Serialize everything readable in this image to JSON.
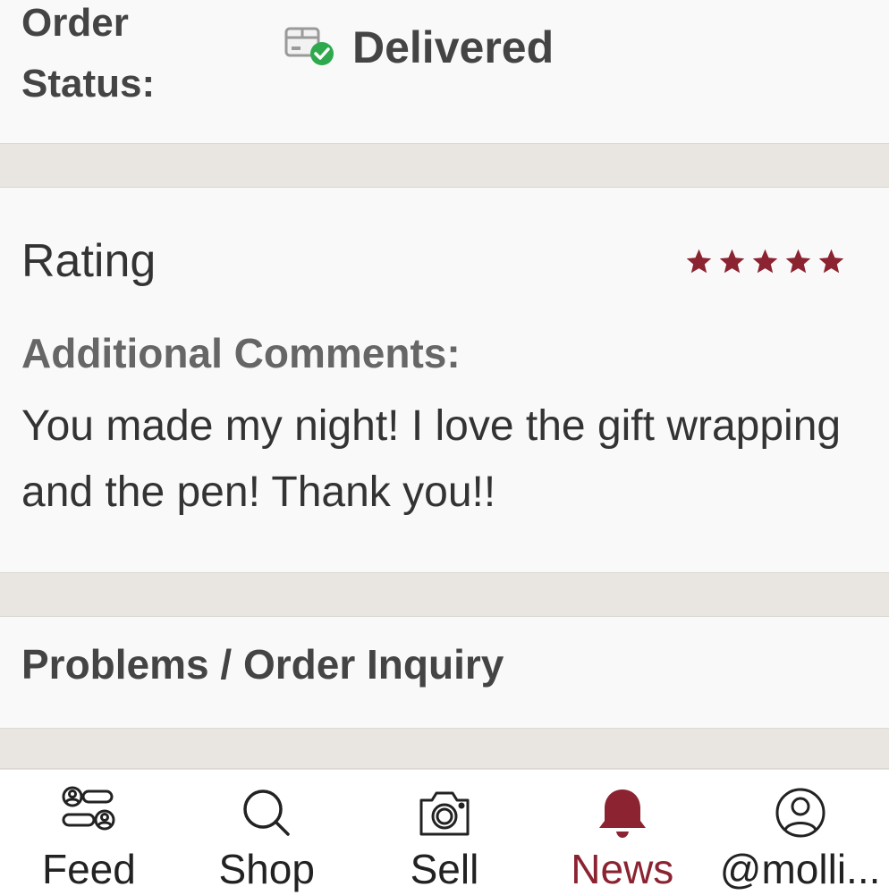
{
  "order_status": {
    "label": "Order Status:",
    "value": "Delivered",
    "icon": "delivered-package-icon"
  },
  "rating": {
    "title": "Rating",
    "stars": 5,
    "max_stars": 5,
    "star_color": "#8b2331"
  },
  "comments": {
    "label": "Additional Comments:",
    "text": "You made my night! I love the gift wrapping and the pen! Thank you!!"
  },
  "problems": {
    "label": "Problems / Order Inquiry"
  },
  "nav": {
    "active_color": "#8b2331",
    "items": [
      {
        "label": "Feed",
        "icon": "feed-icon"
      },
      {
        "label": "Shop",
        "icon": "search-icon"
      },
      {
        "label": "Sell",
        "icon": "camera-icon"
      },
      {
        "label": "News",
        "icon": "bell-icon",
        "active": true
      },
      {
        "label": "@molli...",
        "icon": "profile-icon"
      }
    ]
  }
}
